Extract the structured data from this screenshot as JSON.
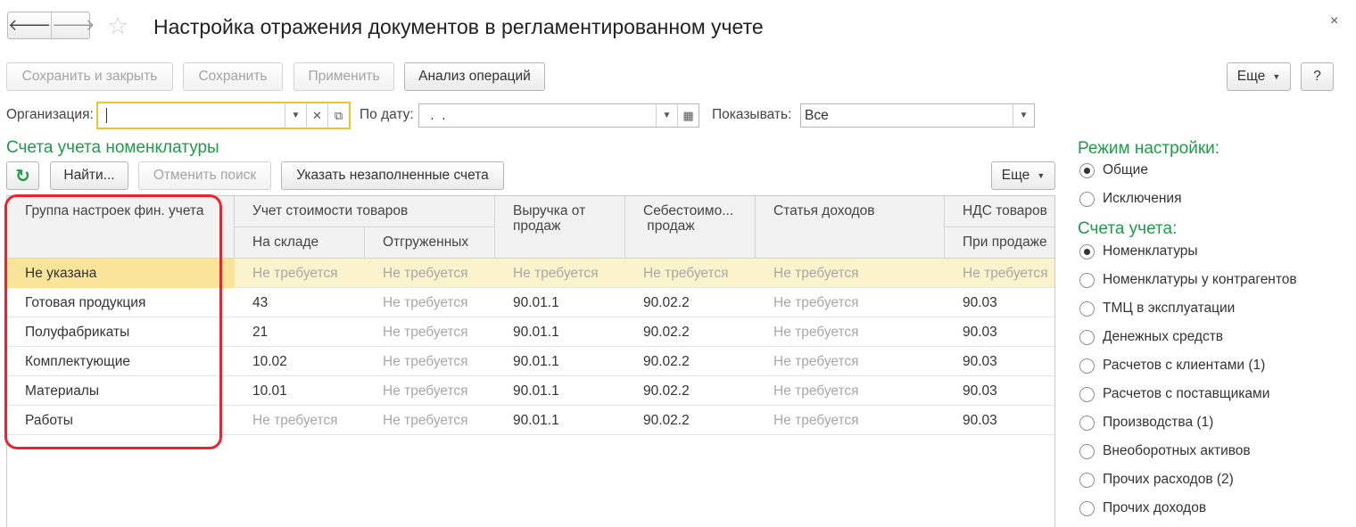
{
  "window": {
    "title": "Настройка отражения документов в регламентированном учете",
    "nav": {
      "back": "🡐",
      "forward": "🡒"
    },
    "star": "☆",
    "close": "×"
  },
  "toolbar": {
    "save_close": "Сохранить и закрыть",
    "save": "Сохранить",
    "apply": "Применить",
    "analysis": "Анализ операций",
    "more": "Еще",
    "help": "?"
  },
  "filters": {
    "org_label": "Организация:",
    "org_value": "",
    "date_label": "По дату:",
    "date_value": " .  .",
    "show_label": "Показывать:",
    "show_value": "Все"
  },
  "section": {
    "title": "Счета учета номенклатуры",
    "refresh_icon": "↻",
    "find": "Найти...",
    "cancel_search": "Отменить поиск",
    "show_unfilled": "Указать незаполненные счета",
    "more": "Еще"
  },
  "table": {
    "headers": {
      "group": "Группа настроек фин. учета",
      "cost": "Учет стоимости товаров",
      "cost_warehouse": "На складе",
      "cost_shipped": "Отгруженных",
      "revenue": "Выручка от\nпродаж",
      "costprice": "Себестоимо...\n продаж",
      "income_item": "Статья доходов",
      "vat": "НДС товаров",
      "vat_sale": "При продаже"
    },
    "rows": [
      {
        "group": "Не указана",
        "warehouse": "Не требуется",
        "shipped": "Не требуется",
        "revenue": "Не требуется",
        "costprice": "Не требуется",
        "income": "Не требуется",
        "vat": "Не требуется"
      },
      {
        "group": "Готовая продукция",
        "warehouse": "43",
        "shipped": "Не требуется",
        "revenue": "90.01.1",
        "costprice": "90.02.2",
        "income": "Не требуется",
        "vat": "90.03"
      },
      {
        "group": "Полуфабрикаты",
        "warehouse": "21",
        "shipped": "Не требуется",
        "revenue": "90.01.1",
        "costprice": "90.02.2",
        "income": "Не требуется",
        "vat": "90.03"
      },
      {
        "group": "Комплектующие",
        "warehouse": "10.02",
        "shipped": "Не требуется",
        "revenue": "90.01.1",
        "costprice": "90.02.2",
        "income": "Не требуется",
        "vat": "90.03"
      },
      {
        "group": "Материалы",
        "warehouse": "10.01",
        "shipped": "Не требуется",
        "revenue": "90.01.1",
        "costprice": "90.02.2",
        "income": "Не требуется",
        "vat": "90.03"
      },
      {
        "group": "Работы",
        "warehouse": "Не требуется",
        "shipped": "Не требуется",
        "revenue": "90.01.1",
        "costprice": "90.02.2",
        "income": "Не требуется",
        "vat": "90.03"
      }
    ],
    "selected_row": 0
  },
  "panel": {
    "mode_title": "Режим настройки:",
    "modes": [
      {
        "label": "Общие",
        "selected": true
      },
      {
        "label": "Исключения",
        "selected": false
      }
    ],
    "accounts_title": "Счета учета:",
    "accounts": [
      {
        "label": "Номенклатуры",
        "selected": true
      },
      {
        "label": "Номенклатуры у контрагентов",
        "selected": false
      },
      {
        "label": "ТМЦ в эксплуатации",
        "selected": false
      },
      {
        "label": "Денежных средств",
        "selected": false
      },
      {
        "label": "Расчетов с клиентами (1)",
        "selected": false
      },
      {
        "label": "Расчетов с поставщиками",
        "selected": false
      },
      {
        "label": "Производства (1)",
        "selected": false
      },
      {
        "label": "Внеоборотных активов",
        "selected": false
      },
      {
        "label": "Прочих расходов (2)",
        "selected": false
      },
      {
        "label": "Прочих доходов",
        "selected": false
      }
    ]
  },
  "colors": {
    "accent_green": "#1d9d48",
    "highlight": "#e8252e",
    "selected_row": "#fbf3cc",
    "focus_border": "#f1c32d"
  }
}
